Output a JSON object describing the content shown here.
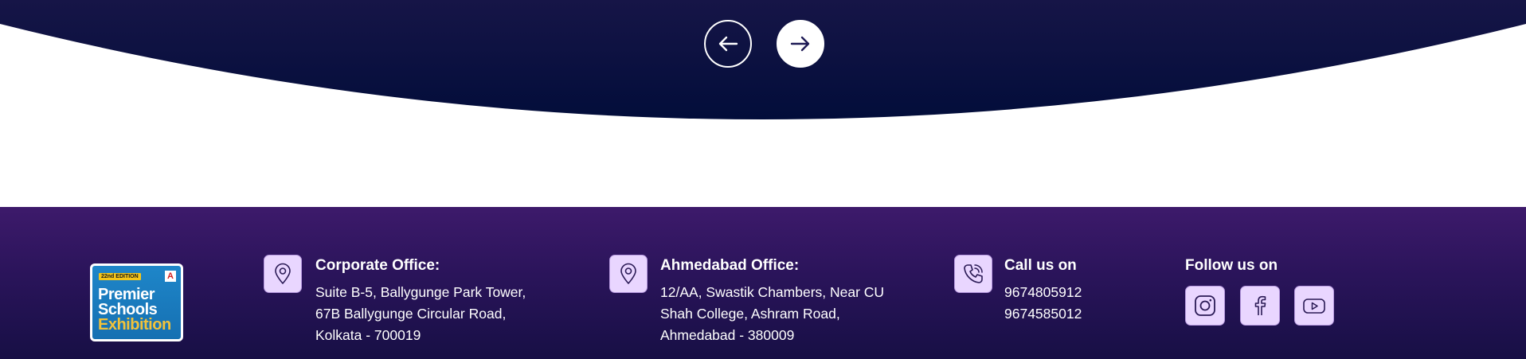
{
  "carousel": {
    "prev_icon": "arrow-left-icon",
    "next_icon": "arrow-right-icon"
  },
  "logo": {
    "edition": "22nd EDITION",
    "line1": "Premier",
    "line2": "Schools",
    "line3": "Exhibition",
    "badge": "A"
  },
  "footer": {
    "corporate": {
      "icon": "location-pin-icon",
      "title": "Corporate Office:",
      "lines": [
        "Suite B-5, Ballygunge Park Tower,",
        "67B Ballygunge Circular Road,",
        "Kolkata - 700019"
      ]
    },
    "ahmedabad": {
      "icon": "location-pin-icon",
      "title": "Ahmedabad Office:",
      "lines": [
        "12/AA, Swastik Chambers, Near CU",
        "Shah College, Ashram Road,",
        "Ahmedabad - 380009"
      ]
    },
    "call": {
      "icon": "phone-icon",
      "title": "Call us on",
      "lines": [
        "9674805912",
        "9674585012"
      ]
    },
    "follow": {
      "title": "Follow us on",
      "icons": [
        "instagram-icon",
        "facebook-icon",
        "youtube-icon"
      ]
    }
  },
  "colors": {
    "curve_top": "#161547",
    "curve_bottom": "#020d3a",
    "footer_top": "#3d1a6b",
    "footer_bottom": "#170f45",
    "icon_box": "#e9d6ff",
    "icon_stroke": "#2a1a55"
  }
}
